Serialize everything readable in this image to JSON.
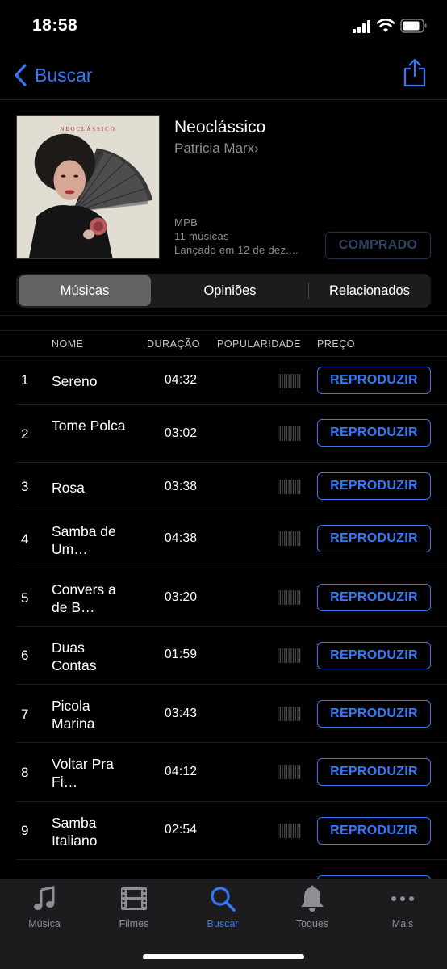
{
  "status": {
    "time": "18:58"
  },
  "nav": {
    "back_label": "Buscar"
  },
  "album": {
    "title": "Neoclássico",
    "artist": "Patricia Marx",
    "artist_chevron": "›",
    "genre": "MPB",
    "track_count": "11 músicas",
    "release": "Lançado em 12 de dez....",
    "art_text": "NEOCLÁSSICO",
    "purchased_label": "COMPRADO"
  },
  "segments": [
    {
      "label": "Músicas",
      "active": true
    },
    {
      "label": "Opiniões",
      "active": false
    },
    {
      "label": "Relacionados",
      "active": false
    }
  ],
  "table": {
    "headers": {
      "name": "NOME",
      "duration": "DURAÇÃO",
      "popularity": "POPULARIDADE",
      "price": "PREÇO"
    },
    "play_label": "REPRODUZIR",
    "rows": [
      {
        "num": "1",
        "name": "Sereno",
        "duration": "04:32"
      },
      {
        "num": "2",
        "name": "Tome Polca",
        "duration": "03:02"
      },
      {
        "num": "3",
        "name": "Rosa",
        "duration": "03:38"
      },
      {
        "num": "4",
        "name": "Samba de Um…",
        "duration": "04:38"
      },
      {
        "num": "5",
        "name": "Convers a de B…",
        "duration": "03:20"
      },
      {
        "num": "6",
        "name": "Duas Contas",
        "duration": "01:59"
      },
      {
        "num": "7",
        "name": "Picola Marina",
        "duration": "03:43"
      },
      {
        "num": "8",
        "name": "Voltar Pra Fi…",
        "duration": "04:12"
      },
      {
        "num": "9",
        "name": "Samba Italiano",
        "duration": "02:54"
      }
    ]
  },
  "tabs": [
    {
      "label": "Música",
      "icon": "music-note-icon",
      "active": false
    },
    {
      "label": "Filmes",
      "icon": "film-icon",
      "active": false
    },
    {
      "label": "Buscar",
      "icon": "search-icon",
      "active": true
    },
    {
      "label": "Toques",
      "icon": "bell-icon",
      "active": false
    },
    {
      "label": "Mais",
      "icon": "more-icon",
      "active": false
    }
  ],
  "colors": {
    "accent": "#3478f6",
    "background": "#000000",
    "secondary_text": "#8e8e93",
    "purchased": "#2d4367"
  }
}
